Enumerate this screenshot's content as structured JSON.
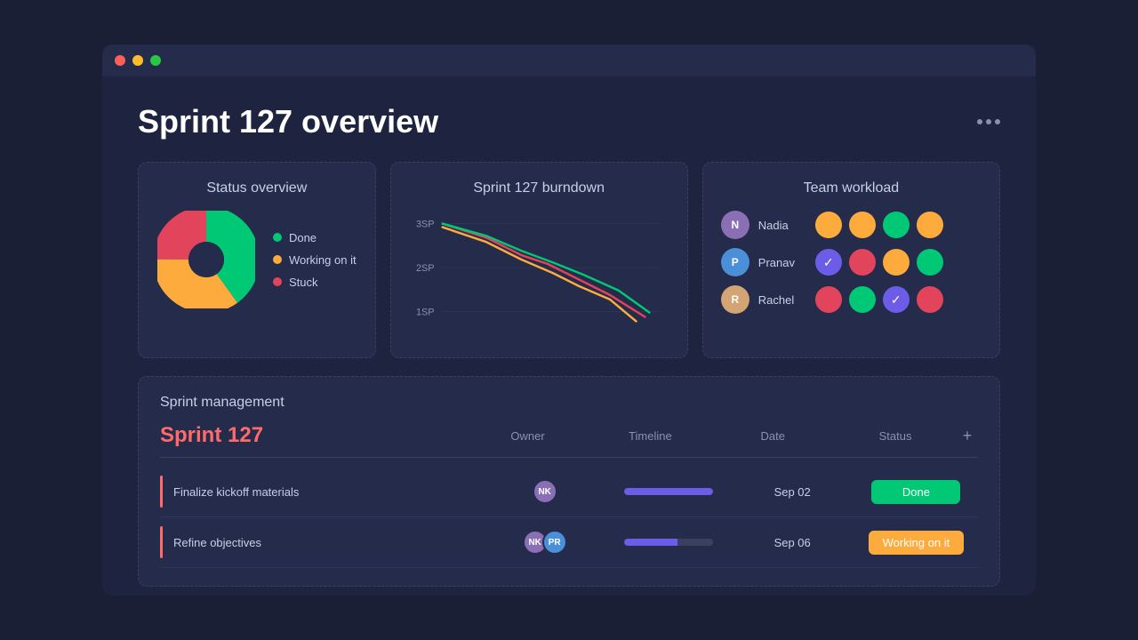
{
  "window": {
    "titlebar_dots": [
      "red",
      "yellow",
      "green"
    ]
  },
  "header": {
    "title": "Sprint 127 overview",
    "more_label": "..."
  },
  "status_overview": {
    "title": "Status overview",
    "legend": [
      {
        "label": "Done",
        "color": "#00c875"
      },
      {
        "label": "Working on it",
        "color": "#fdab3d"
      },
      {
        "label": "Stuck",
        "color": "#e2445c"
      }
    ],
    "pie": {
      "done_pct": 40,
      "working_pct": 35,
      "stuck_pct": 25
    }
  },
  "burndown": {
    "title": "Sprint 127 burndown",
    "y_labels": [
      "3SP",
      "2SP",
      "1SP"
    ],
    "lines": [
      {
        "color": "#e2445c",
        "label": "red"
      },
      {
        "color": "#fdab3d",
        "label": "orange"
      },
      {
        "color": "#00c875",
        "label": "green"
      }
    ]
  },
  "workload": {
    "title": "Team workload",
    "members": [
      {
        "name": "Nadia",
        "avatar_color": "#8b6fb5",
        "initials": "N",
        "dots": [
          {
            "color": "#fdab3d",
            "type": "plain"
          },
          {
            "color": "#fdab3d",
            "type": "plain"
          },
          {
            "color": "#00c875",
            "type": "plain"
          },
          {
            "color": "#fdab3d",
            "type": "plain"
          }
        ]
      },
      {
        "name": "Pranav",
        "avatar_color": "#4a90d9",
        "initials": "P",
        "dots": [
          {
            "color": "#6c5ce7",
            "type": "check"
          },
          {
            "color": "#e2445c",
            "type": "plain"
          },
          {
            "color": "#fdab3d",
            "type": "plain"
          },
          {
            "color": "#00c875",
            "type": "plain"
          }
        ]
      },
      {
        "name": "Rachel",
        "avatar_color": "#d4a574",
        "initials": "R",
        "dots": [
          {
            "color": "#e2445c",
            "type": "plain"
          },
          {
            "color": "#00c875",
            "type": "plain"
          },
          {
            "color": "#6c5ce7",
            "type": "check"
          },
          {
            "color": "#e2445c",
            "type": "plain"
          }
        ]
      }
    ]
  },
  "sprint_management": {
    "section_title": "Sprint management",
    "sprint_label": "Sprint 127",
    "columns": [
      "Owner",
      "Timeline",
      "Date",
      "Status"
    ],
    "tasks": [
      {
        "name": "Finalize kickoff materials",
        "owner_initials": [
          "NK"
        ],
        "owner_colors": [
          "#8b6fb5"
        ],
        "timeline_fill": 100,
        "timeline_color": "#6c5ce7",
        "date": "Sep 02",
        "status": "Done",
        "status_type": "done"
      },
      {
        "name": "Refine objectives",
        "owner_initials": [
          "NK",
          "PR"
        ],
        "owner_colors": [
          "#8b6fb5",
          "#4a90d9"
        ],
        "timeline_fill": 60,
        "timeline_color": "#6c5ce7",
        "date": "Sep 06",
        "status": "Working on it",
        "status_type": "working"
      }
    ]
  }
}
